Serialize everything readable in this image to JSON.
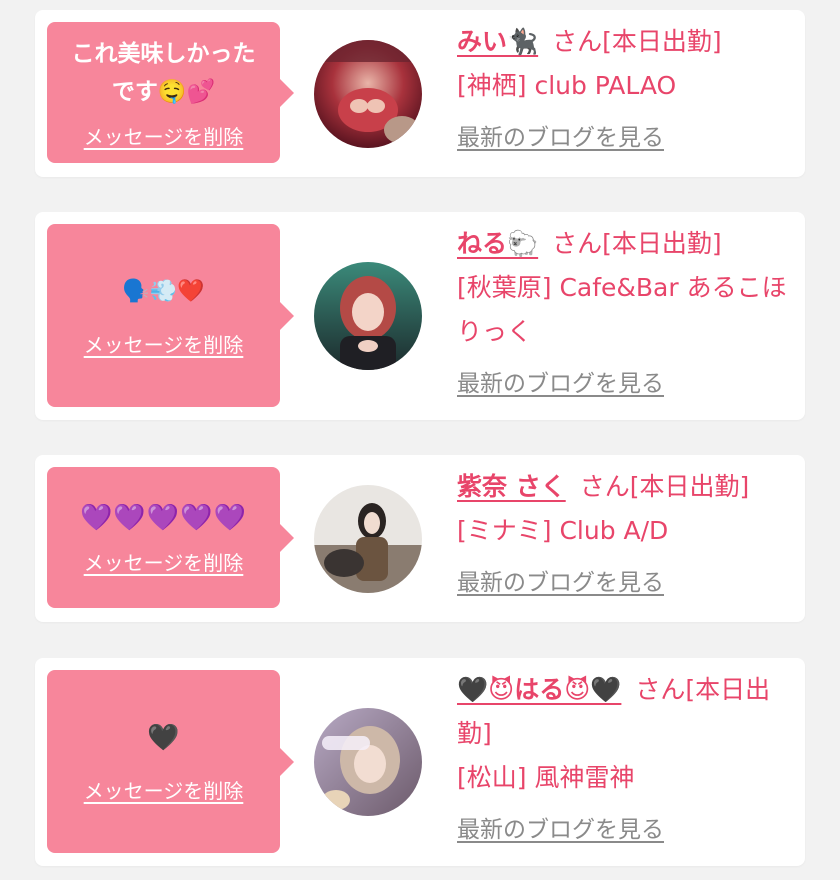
{
  "cards": [
    {
      "message": "これ美味しかった\nです🤤💕",
      "delete_label": "メッセージを削除",
      "name": "みい🐈‍⬛",
      "honorific": "さん[本日出勤]",
      "shop": "[神栖] club PALAO",
      "blog_label": "最新のブログを見る"
    },
    {
      "message": "🗣️💨❤️",
      "delete_label": "メッセージを削除",
      "name": "ねる🐑",
      "honorific": "さん[本日出勤]",
      "shop": "[秋葉原] Cafe&Bar あるこほりっく",
      "blog_label": "最新のブログを見る"
    },
    {
      "message": "💜💜💜💜💜",
      "delete_label": "メッセージを削除",
      "name": "紫奈 さく",
      "honorific": "さん[本日出勤]",
      "shop": "[ミナミ] Club A/D",
      "blog_label": "最新のブログを見る"
    },
    {
      "message": "🖤",
      "delete_label": "メッセージを削除",
      "name": "🖤😈はる😈🖤",
      "honorific": "さん[本日出勤]",
      "shop": "[松山] 風神雷神",
      "blog_label": "最新のブログを見る"
    }
  ],
  "colors": {
    "bubble": "#f7869b",
    "accent": "#e8456a",
    "link_gray": "#8a8a8a",
    "background": "#f2f2f2"
  }
}
